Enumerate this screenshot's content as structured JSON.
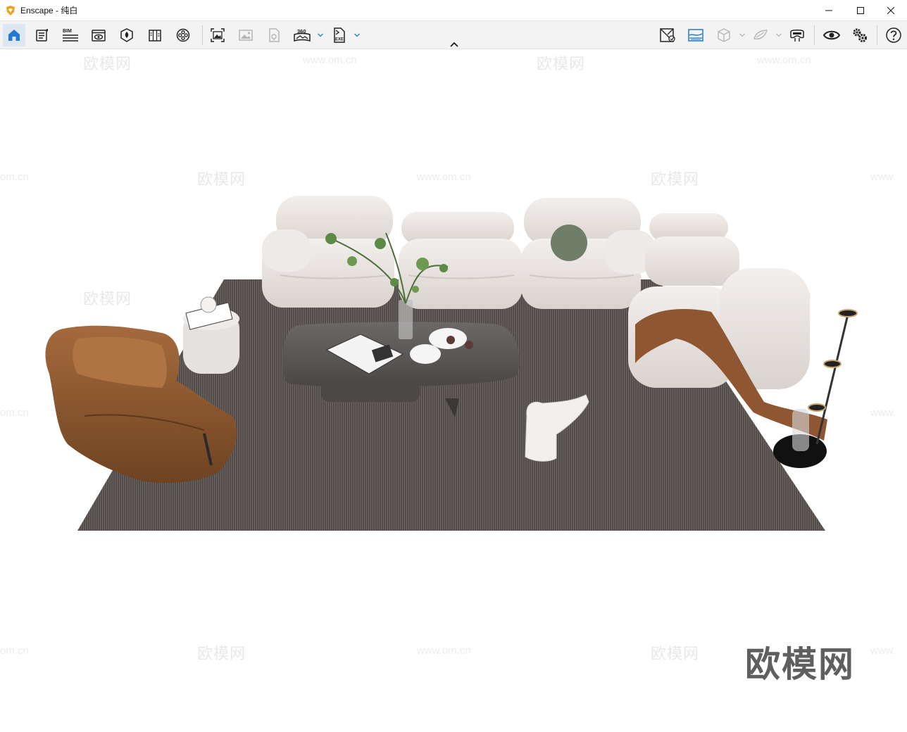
{
  "window": {
    "title": "Enscape - 纯白",
    "minimize_icon": "minimize-icon",
    "maximize_icon": "maximize-icon",
    "close_icon": "close-icon"
  },
  "toolbar": {
    "bim_label": "BIM",
    "pano_label": "360",
    "exe_label": "EXE",
    "left_items": [
      "home-icon",
      "notes-icon",
      "bim-icon",
      "views-icon",
      "asset-library-icon",
      "material-editor-icon",
      "video-editor-icon",
      "screenshot-icon",
      "batch-render-icon",
      "collaborative-annotation-icon",
      "panorama-icon",
      "export-exe-icon"
    ],
    "right_items": [
      "synced-view-icon",
      "visual-settings-icon",
      "orthographic-icon",
      "section-icon",
      "vr-headset-icon",
      "eye-icon",
      "settings-icon",
      "help-icon"
    ]
  },
  "watermark": {
    "brand": "欧模网",
    "url": "www.om.cn",
    "url_partial_left": "om.cn",
    "url_partial_right": "www."
  }
}
